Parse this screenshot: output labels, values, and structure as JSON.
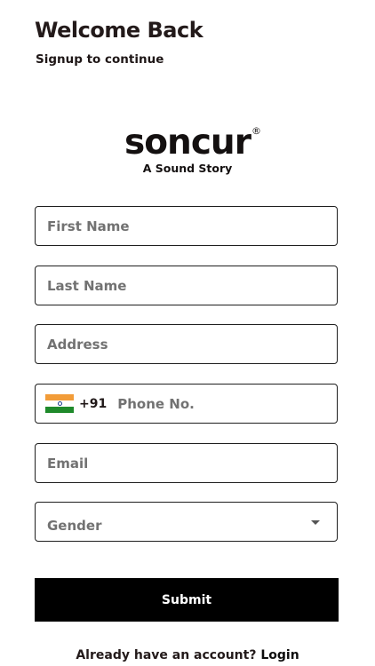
{
  "header": {
    "title": "Welcome Back",
    "subtitle": "Signup to continue"
  },
  "logo": {
    "wordmark": "soncur",
    "registered": "®",
    "tagline": "A Sound Story"
  },
  "form": {
    "first_name": {
      "placeholder": "First Name",
      "value": ""
    },
    "last_name": {
      "placeholder": "Last Name",
      "value": ""
    },
    "address": {
      "placeholder": "Address",
      "value": ""
    },
    "phone": {
      "country_flag": "india-flag-icon",
      "dial_code": "+91",
      "placeholder": "Phone No.",
      "value": ""
    },
    "email": {
      "placeholder": "Email",
      "value": ""
    },
    "gender": {
      "selected": "Gender",
      "icon": "caret-down-icon"
    },
    "submit_label": "Submit"
  },
  "footer": {
    "prompt": "Already have an account?",
    "login_label": "Login"
  },
  "colors": {
    "button_bg": "#000000",
    "button_text": "#ffffff",
    "border": "#1e1e1e",
    "placeholder": "#727272",
    "flag_saffron": "#f29c38",
    "flag_green": "#1f8a2b"
  }
}
